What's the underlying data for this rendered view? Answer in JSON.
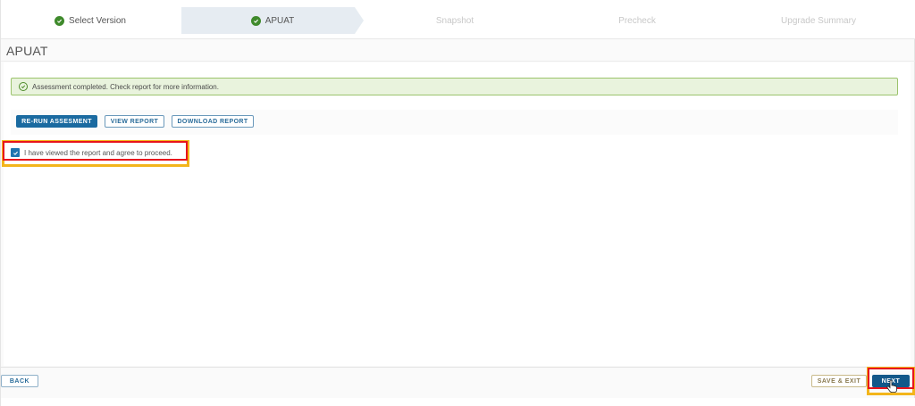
{
  "stepper": {
    "steps": [
      {
        "label": "Select Version",
        "state": "completed"
      },
      {
        "label": "APUAT",
        "state": "active"
      },
      {
        "label": "Snapshot",
        "state": "future"
      },
      {
        "label": "Precheck",
        "state": "future"
      },
      {
        "label": "Upgrade Summary",
        "state": "future"
      }
    ]
  },
  "page": {
    "title": "APUAT"
  },
  "alert": {
    "type": "success",
    "icon": "check-circle-icon",
    "message": "Assessment completed. Check report for more information."
  },
  "actions": {
    "rerun_label": "RE-RUN ASSESMENT",
    "view_label": "VIEW REPORT",
    "download_label": "DOWNLOAD REPORT"
  },
  "agreement": {
    "checked": true,
    "label": "I have viewed the report and agree to proceed."
  },
  "footer": {
    "back_label": "BACK",
    "save_exit_label": "SAVE & EXIT",
    "next_label": "NEXT"
  },
  "colors": {
    "primary": "#1a6aa0",
    "success_border": "#9bc36c",
    "success_bg": "#e9f3dd",
    "check_green": "#3f8a2c",
    "highlight_red": "#e8141c",
    "highlight_yellow": "#f3b51b"
  }
}
